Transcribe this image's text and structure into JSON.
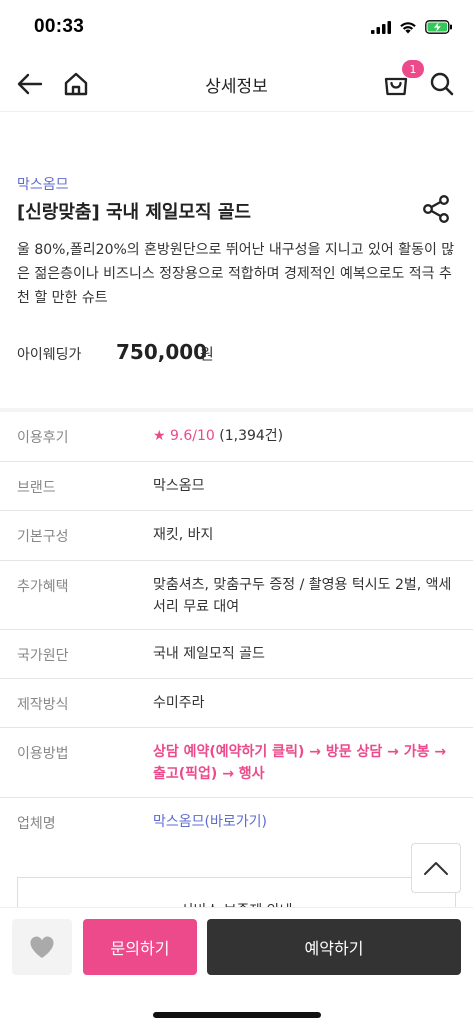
{
  "status": {
    "time": "00:33"
  },
  "header": {
    "title": "상세정보",
    "cart_count": "1"
  },
  "product": {
    "brand": "막스옴므",
    "title": "[신랑맞춤] 국내 제일모직 골드",
    "description": "울 80%,폴리20%의 혼방원단으로 뛰어난 내구성을 지니고 있어 활동이 많은 젊은층이나 비즈니스 정장용으로 적합하며 경제적인 예복으로도 적극 추천 할 만한 슈트",
    "price_label": "아이웨딩가",
    "price": "750,000",
    "price_unit": "원"
  },
  "info": {
    "review": {
      "label": "이용후기",
      "star": "★",
      "score": "9.6/10",
      "count": "(1,394건)"
    },
    "brand": {
      "label": "브랜드",
      "value": "막스옴므"
    },
    "composition": {
      "label": "기본구성",
      "value": "재킷, 바지"
    },
    "benefits": {
      "label": "추가혜택",
      "value": "맞춤셔츠, 맞춤구두 증정 / 촬영용 턱시도 2벌, 액세서리 무료 대여"
    },
    "origin": {
      "label": "국가원단",
      "value": "국내 제일모직 골드"
    },
    "method": {
      "label": "제작방식",
      "value": "수미주라"
    },
    "usage": {
      "label": "이용방법",
      "value": "상담 예약(예약하기 클릭) → 방문 상담 → 가봉 → 출고(픽업) → 행사"
    },
    "vendor": {
      "label": "업체명",
      "value": "막스옴므(바로가기)"
    }
  },
  "service_box": {
    "label": "서비스 보증제 안내"
  },
  "bottom_bar": {
    "inquiry_label": "문의하기",
    "reserve_label": "예약하기"
  },
  "colors": {
    "accent": "#ec4a8a",
    "link": "#5e6bd1",
    "dark_button": "#333333"
  }
}
